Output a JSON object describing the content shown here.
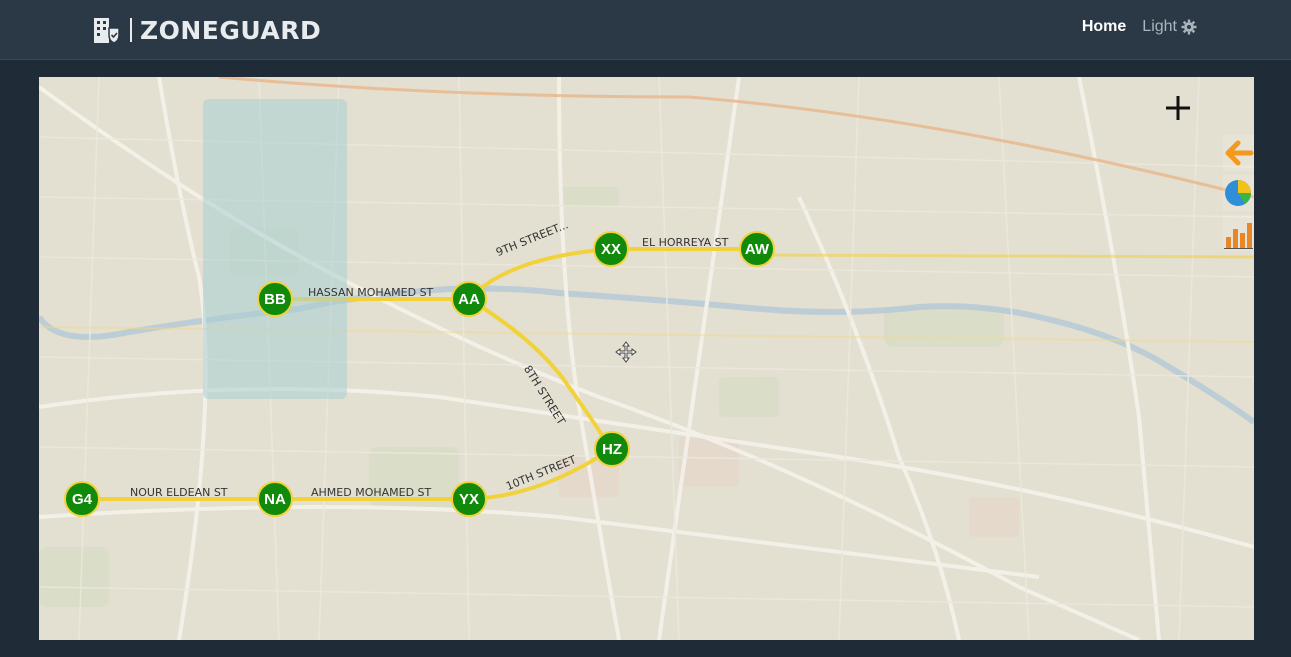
{
  "header": {
    "brand": "ZONEGUARD",
    "nav": {
      "home": "Home",
      "theme": "Light"
    }
  },
  "colors": {
    "header_bg": "#2b3946",
    "page_bg": "#1f2b36",
    "map_bg": "#e3dfd1",
    "station_fill": "#118a0c",
    "route_color": "#f2d23a",
    "zone_fill": "#aad0d4"
  },
  "map": {
    "stations": [
      "BB",
      "AA",
      "XX",
      "AW",
      "HZ",
      "G4",
      "NA",
      "YX"
    ],
    "streets": [
      "HASSAN MOHAMED ST",
      "9TH STREET...",
      "EL HORREYA ST",
      "8TH STREET",
      "NOUR ELDEAN ST",
      "AHMED MOHAMED ST",
      "10TH STREET"
    ],
    "controls": [
      "plus-icon",
      "back-arrow-icon",
      "pie-chart-icon",
      "bar-chart-icon",
      "move-icon"
    ]
  }
}
